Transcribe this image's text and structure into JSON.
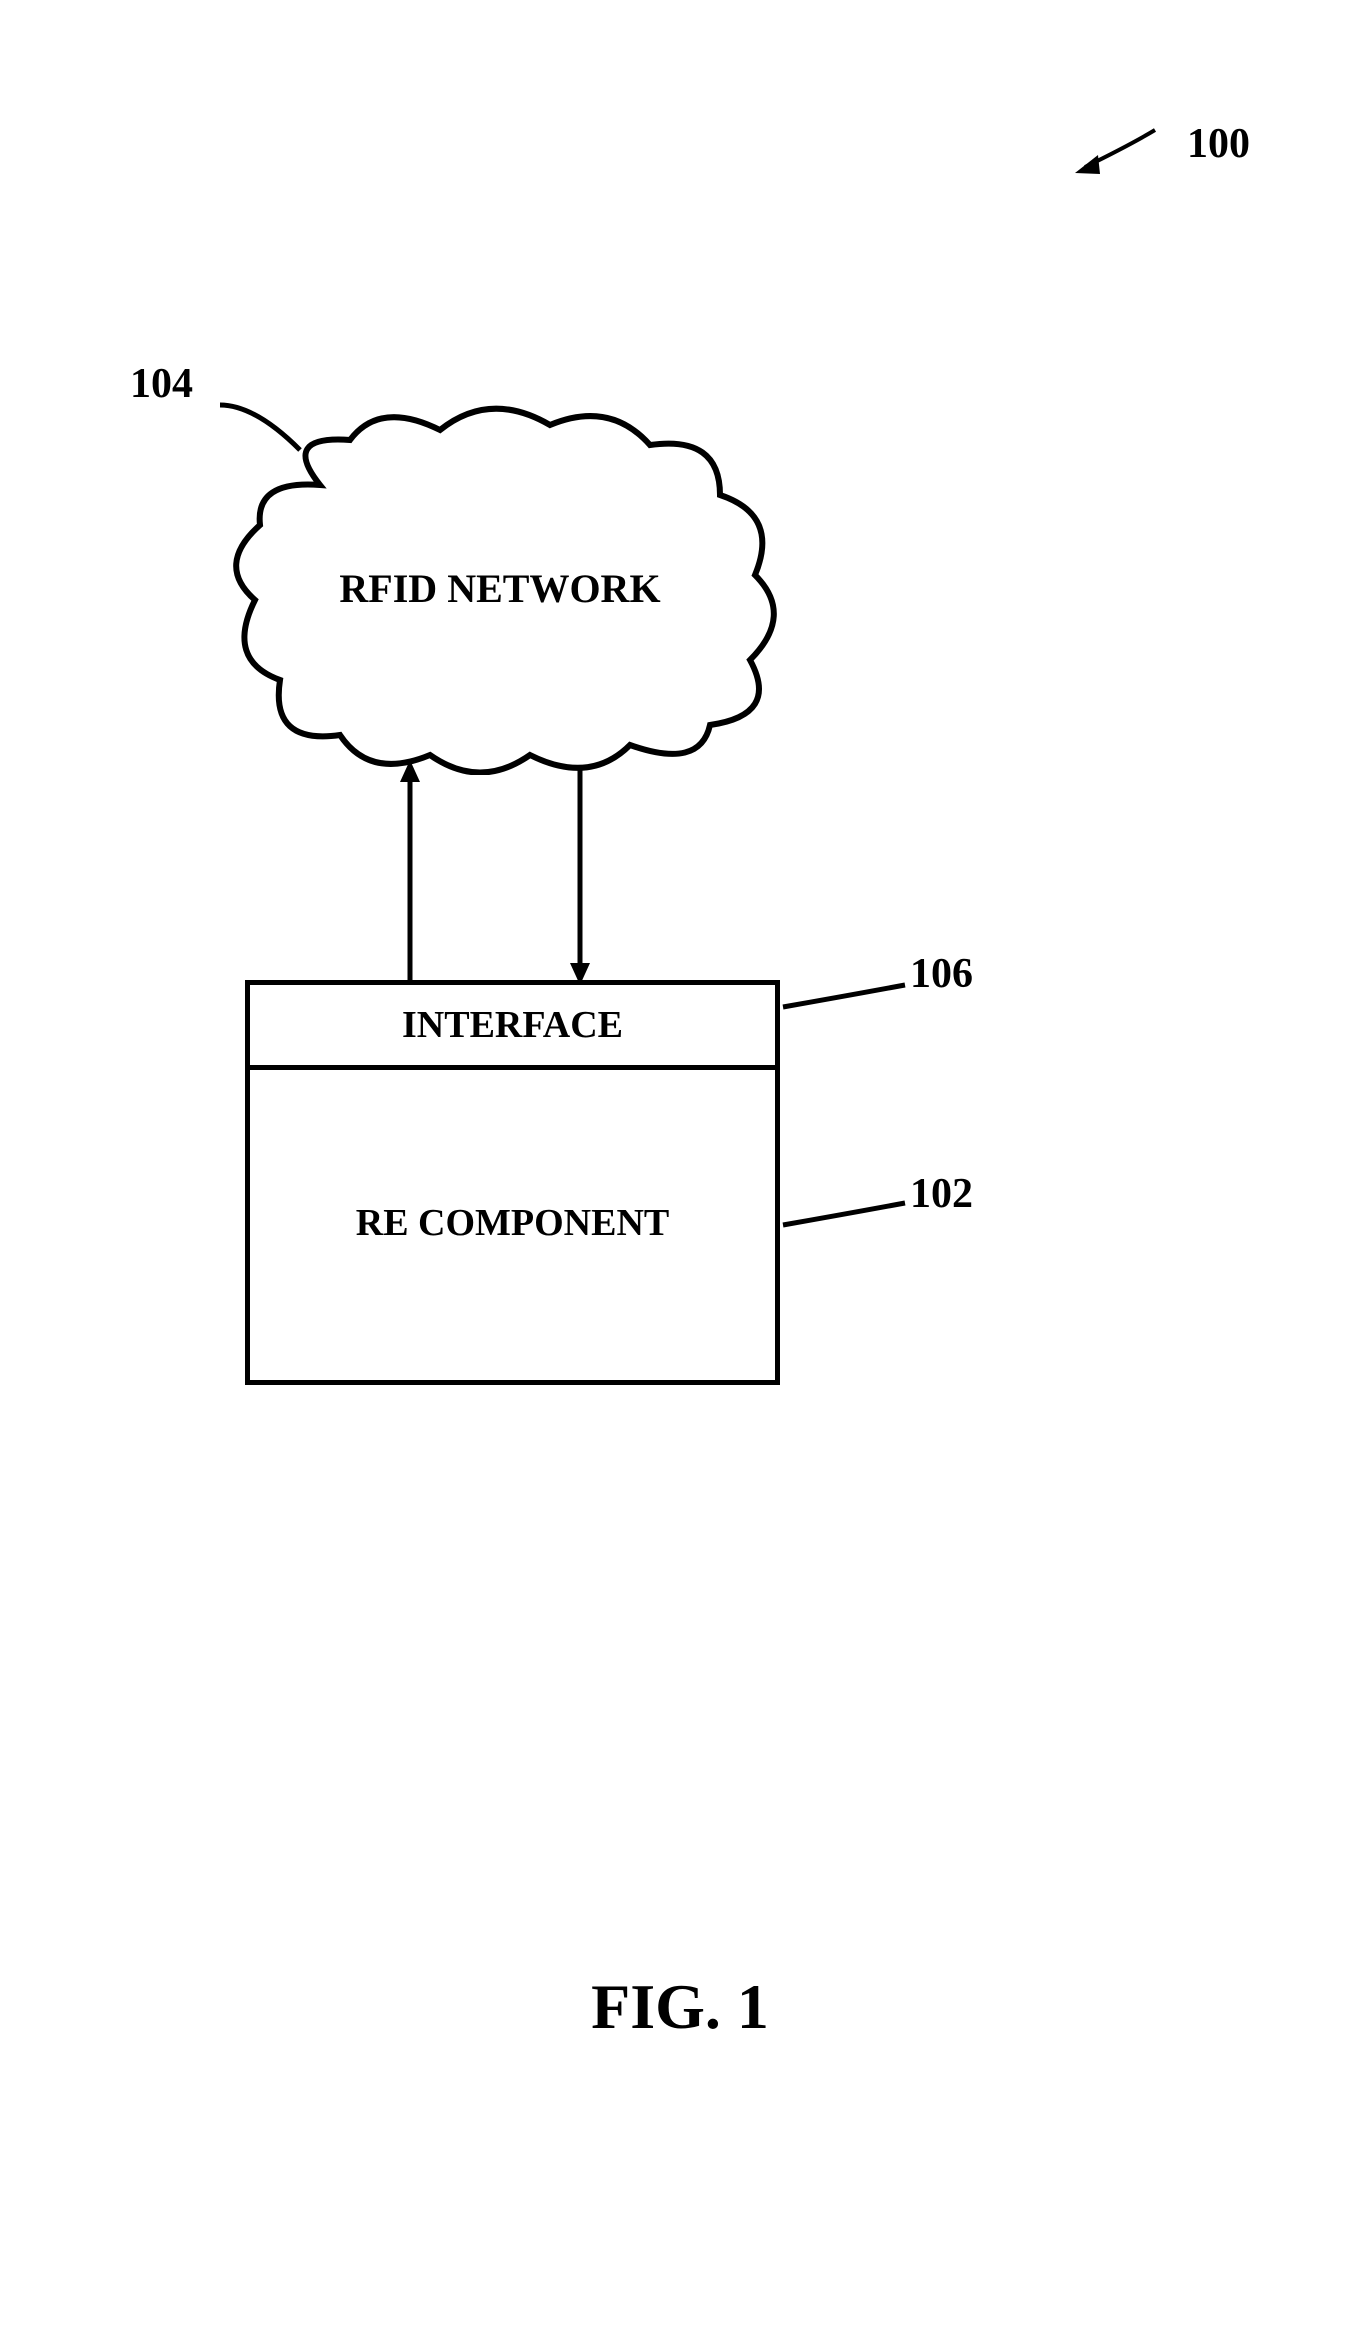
{
  "figure": {
    "label": "FIG. 1",
    "ref_system": "100"
  },
  "cloud": {
    "label": "RFID NETWORK",
    "ref": "104"
  },
  "interface": {
    "label": "INTERFACE",
    "ref": "106"
  },
  "component": {
    "label": "RE COMPONENT",
    "ref": "102"
  }
}
